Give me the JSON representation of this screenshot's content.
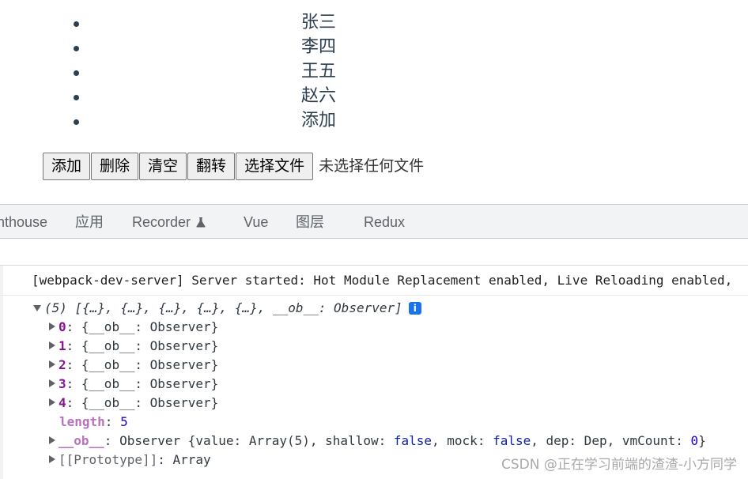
{
  "app": {
    "names": [
      "张三",
      "李四",
      "王五",
      "赵六",
      "添加"
    ],
    "buttons": {
      "add": "添加",
      "delete": "删除",
      "clear": "清空",
      "reverse": "翻转",
      "choose_file": "选择文件"
    },
    "file_status": "未选择任何文件"
  },
  "devtools": {
    "tabs": {
      "lighthouse": "nthouse",
      "application": "应用",
      "recorder": "Recorder",
      "vue": "Vue",
      "layers": "图层",
      "redux": "Redux"
    },
    "console": {
      "log_message": "[webpack-dev-server] Server started: Hot Module Replacement enabled, Live Reloading enabled,",
      "array_summary": "(5) [{…}, {…}, {…}, {…}, {…}, __ob__: Observer]",
      "entries": [
        {
          "key": "0",
          "value": "{__ob__: Observer}"
        },
        {
          "key": "1",
          "value": "{__ob__: Observer}"
        },
        {
          "key": "2",
          "value": "{__ob__: Observer}"
        },
        {
          "key": "3",
          "value": "{__ob__: Observer}"
        },
        {
          "key": "4",
          "value": "{__ob__: Observer}"
        }
      ],
      "length_key": "length",
      "length_value": "5",
      "ob_key": "__ob__",
      "ob_value_prefix": "Observer {value: Array(5), shallow: ",
      "ob_shallow": "false",
      "ob_mid": ", mock: ",
      "ob_mock": "false",
      "ob_dep": ", dep: Dep, vmCount: ",
      "ob_vmcount": "0",
      "ob_close": "}",
      "proto_key": "[[Prototype]]",
      "proto_value": "Array"
    }
  },
  "watermark": "CSDN @正在学习前端的渣渣-小方同学",
  "icons": {
    "recorder": "flask-icon",
    "info": "info-icon",
    "expand": "triangle-right-icon",
    "collapse": "triangle-down-icon"
  },
  "colors": {
    "text": "#2c3e50",
    "devtools_tabbar": "#f1f3f4",
    "console_key": "#881391",
    "console_keyword": "#0d22aa",
    "console_number": "#1c00cf",
    "info_badge": "#1a73e8"
  }
}
